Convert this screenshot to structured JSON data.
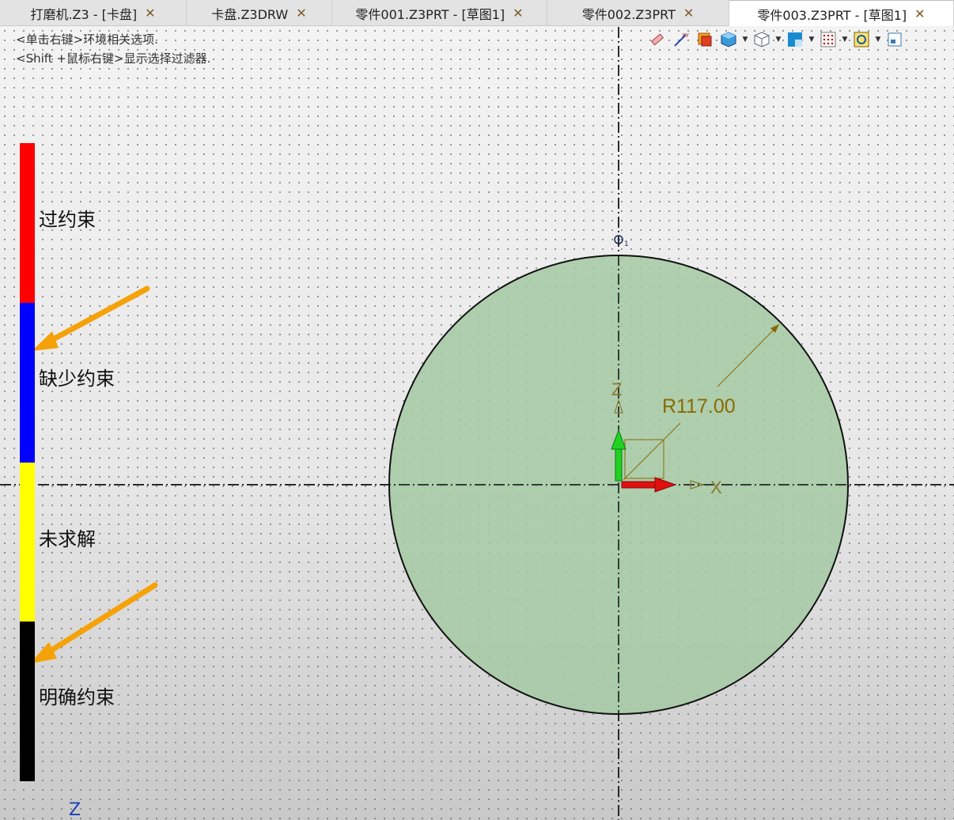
{
  "tabs": [
    {
      "label": "打磨机.Z3 - [卡盘]",
      "active": false
    },
    {
      "label": "卡盘.Z3DRW",
      "active": false
    },
    {
      "label": "零件001.Z3PRT - [草图1]",
      "active": false
    },
    {
      "label": "零件002.Z3PRT",
      "active": false
    },
    {
      "label": "零件003.Z3PRT - [草图1]",
      "active": true
    }
  ],
  "close_glyph": "✕",
  "hints": [
    "<单击右键>环境相关选项.",
    "<Shift +鼠标右键>显示选择过滤器."
  ],
  "toolbar": {
    "icons": [
      "eraser-icon",
      "xy-axis-icon",
      "render-settings-icon",
      "shaded-cube-icon",
      "wireframe-cube-icon",
      "view-layout-icon",
      "grid-dots-icon",
      "filter-icon",
      "more-icon"
    ]
  },
  "legend": {
    "items": [
      {
        "label": "过约束",
        "color": "#ff0000"
      },
      {
        "label": "缺少约束",
        "color": "#0000ff"
      },
      {
        "label": "未求解",
        "color": "#ffff00"
      },
      {
        "label": "明确约束",
        "color": "#000000"
      }
    ]
  },
  "sketch": {
    "dimension_label": "R117.00",
    "axis_z": "Z",
    "axis_x": "X",
    "point_label": "1",
    "circle_fill": "#a3c9a3",
    "dimension_color": "#8a6a00",
    "arrow_color": "#f5a20a"
  },
  "bottom_axis_label": "Z"
}
